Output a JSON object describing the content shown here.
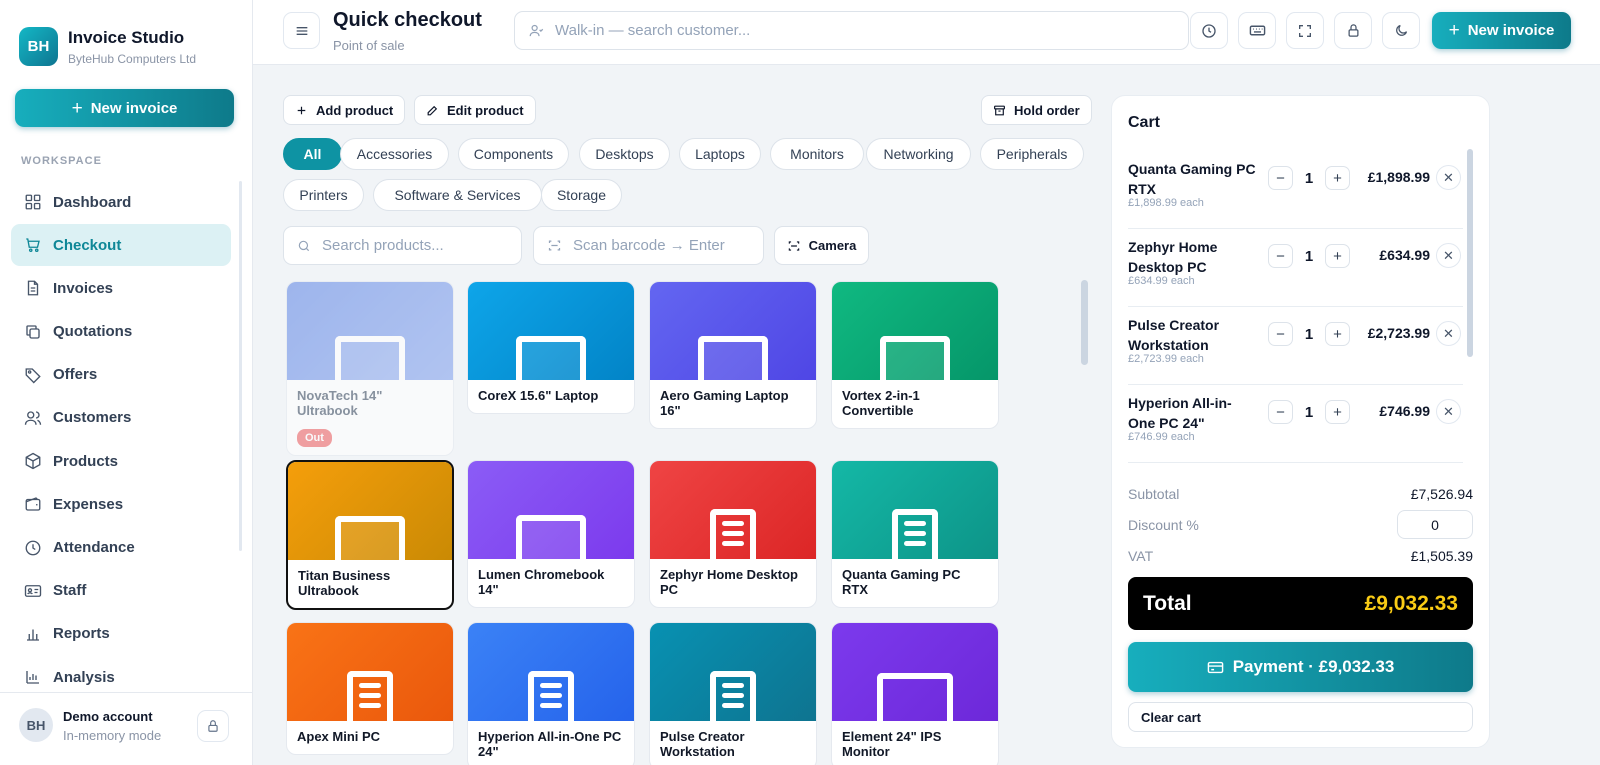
{
  "brand": {
    "initials": "BH",
    "name": "Invoice Studio",
    "company": "ByteHub Computers Ltd"
  },
  "sidebar": {
    "new_invoice": "New invoice",
    "section_label": "WORKSPACE",
    "items": [
      {
        "label": "Dashboard",
        "icon": "dashboard-icon"
      },
      {
        "label": "Checkout",
        "icon": "cart-icon",
        "active": true
      },
      {
        "label": "Invoices",
        "icon": "document-icon"
      },
      {
        "label": "Quotations",
        "icon": "copy-icon"
      },
      {
        "label": "Offers",
        "icon": "tag-icon"
      },
      {
        "label": "Customers",
        "icon": "users-icon"
      },
      {
        "label": "Products",
        "icon": "box-icon"
      },
      {
        "label": "Expenses",
        "icon": "wallet-icon"
      },
      {
        "label": "Attendance",
        "icon": "clock-icon"
      },
      {
        "label": "Staff",
        "icon": "id-card-icon"
      },
      {
        "label": "Reports",
        "icon": "bar-chart-icon"
      },
      {
        "label": "Analysis",
        "icon": "analysis-icon"
      }
    ],
    "account": {
      "initials": "BH",
      "name": "Demo account",
      "mode": "In-memory mode"
    }
  },
  "header": {
    "title": "Quick checkout",
    "subtitle": "Point of sale",
    "customer_search_placeholder": "Walk-in — search customer...",
    "new_invoice": "New invoice"
  },
  "toolbar": {
    "add_product": "Add product",
    "edit_product": "Edit product",
    "hold_order": "Hold order"
  },
  "categories": [
    "All",
    "Accessories",
    "Components",
    "Desktops",
    "Laptops",
    "Monitors",
    "Networking",
    "Peripherals",
    "Printers",
    "Software & Services",
    "Storage"
  ],
  "search": {
    "products_placeholder": "Search products...",
    "barcode_placeholder": "Scan barcode → Enter",
    "camera": "Camera"
  },
  "products": [
    {
      "name": "NovaTech 14\" Ultrabook",
      "kind": "laptop",
      "grad": [
        "#6b8fe6",
        "#8aa7ee"
      ],
      "out_of_stock": true,
      "badge": "Out"
    },
    {
      "name": "CoreX 15.6\" Laptop",
      "kind": "laptop",
      "grad": [
        "#0ea5e9",
        "#0284c7"
      ]
    },
    {
      "name": "Aero Gaming Laptop 16\"",
      "kind": "laptop",
      "grad": [
        "#6366f1",
        "#4f46e5"
      ]
    },
    {
      "name": "Vortex 2-in-1 Convertible",
      "kind": "laptop",
      "grad": [
        "#10b981",
        "#059669"
      ]
    },
    {
      "name": "Titan Business Ultrabook",
      "kind": "laptop",
      "grad": [
        "#f59e0b",
        "#ca8a04"
      ],
      "selected": true
    },
    {
      "name": "Lumen Chromebook 14\"",
      "kind": "laptop",
      "grad": [
        "#8b5cf6",
        "#7c3aed"
      ]
    },
    {
      "name": "Zephyr Home Desktop PC",
      "kind": "tower",
      "grad": [
        "#ef4444",
        "#dc2626"
      ]
    },
    {
      "name": "Quanta Gaming PC RTX",
      "kind": "tower",
      "grad": [
        "#14b8a6",
        "#0d9488"
      ]
    },
    {
      "name": "Apex Mini PC",
      "kind": "tower",
      "grad": [
        "#f97316",
        "#ea580c"
      ]
    },
    {
      "name": "Hyperion All-in-One PC 24\"",
      "kind": "tower",
      "grad": [
        "#3b82f6",
        "#2563eb"
      ]
    },
    {
      "name": "Pulse Creator Workstation",
      "kind": "tower",
      "grad": [
        "#0891b2",
        "#0e7490"
      ]
    },
    {
      "name": "Element 24\" IPS Monitor",
      "kind": "monitor",
      "grad": [
        "#7c3aed",
        "#6d28d9"
      ]
    }
  ],
  "cart": {
    "title": "Cart",
    "items": [
      {
        "name": "Quanta Gaming PC RTX",
        "each": "£1,898.99 each",
        "qty": "1",
        "price": "£1,898.99"
      },
      {
        "name": "Zephyr Home Desktop PC",
        "each": "£634.99 each",
        "qty": "1",
        "price": "£634.99"
      },
      {
        "name": "Pulse Creator Workstation",
        "each": "£2,723.99 each",
        "qty": "1",
        "price": "£2,723.99"
      },
      {
        "name": "Hyperion All-in-One PC 24\"",
        "each": "£746.99 each",
        "qty": "1",
        "price": "£746.99"
      }
    ],
    "subtotal_label": "Subtotal",
    "subtotal": "£7,526.94",
    "discount_label": "Discount %",
    "discount": "0",
    "vat_label": "VAT",
    "vat": "£1,505.39",
    "total_label": "Total",
    "total": "£9,032.33",
    "payment": "Payment · £9,032.33",
    "clear": "Clear cart"
  },
  "colors": {
    "accent": "#0e93a3",
    "total_bg": "#000000",
    "total_value": "#facc15",
    "out_badge": "#ef6b6b"
  }
}
